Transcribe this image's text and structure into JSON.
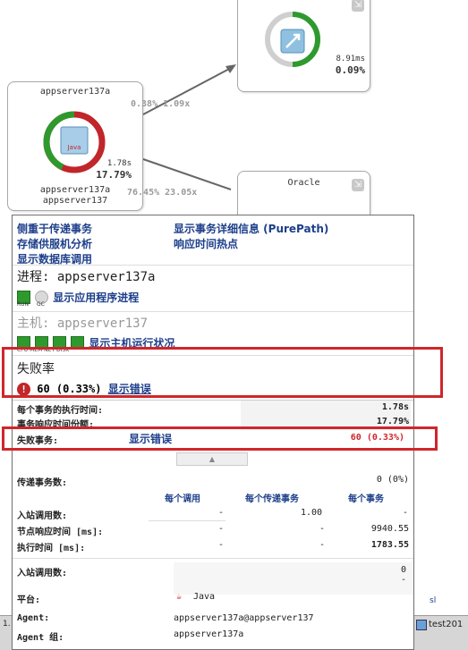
{
  "nodes": {
    "top_right": {
      "metric_ms": "8.91ms",
      "metric_pct": "0.09%"
    },
    "appserver": {
      "title": "appserver137a",
      "java_label": "Java",
      "metric_ms": "1.78s",
      "metric_pct": "17.79%",
      "sub1": "appserver137a",
      "sub2": "appserver137"
    },
    "oracle": {
      "title": "Oracle"
    }
  },
  "edges": {
    "upper": "0.38% 1.09x",
    "lower": "76.45% 23.05x"
  },
  "popup": {
    "links_left": [
      "侧重于传递事务",
      "存储供服机分析",
      "显示数据库调用"
    ],
    "links_right": [
      "显示事务详细信息 (PurePath)",
      "响应时间热点"
    ],
    "process": {
      "title": "进程: appserver137a",
      "link": "显示应用程序进程",
      "labels": [
        "RUN",
        "GC"
      ]
    },
    "host": {
      "title": "主机: appserver137",
      "link": "显示主机运行状况",
      "labels": "CPU MEM NET DISK"
    },
    "failure": {
      "title": "失败率",
      "value": "60 (0.33%)",
      "link": "显示错误"
    },
    "metrics": [
      {
        "label": "每个事务的执行时间:",
        "value": "1.78s"
      },
      {
        "label": "事务响应时间份额:",
        "value": "17.79%"
      }
    ],
    "fail_row": {
      "label": "失败事务:",
      "link": "显示错误",
      "value": "60 (0.33%)"
    },
    "passing": {
      "label": "传递事务数:",
      "value": "0 (0%)"
    },
    "table": {
      "headers": [
        "每个调用",
        "每个传递事务",
        "每个事务"
      ],
      "rows": [
        {
          "label": "入站调用数:",
          "c1": "-",
          "c2": "1.00",
          "c3": "-"
        },
        {
          "label": "节点响应时间 [ms]:",
          "c1": "-",
          "c2": "-",
          "c3": "9940.55"
        },
        {
          "label": "执行时间 [ms]:",
          "c1": "-",
          "c2": "-",
          "c3": "1783.55"
        }
      ]
    },
    "inbound": {
      "label": "入站调用数:",
      "value": "0",
      "dash": "-"
    },
    "platform": {
      "label": "平台:",
      "value": "Java"
    },
    "agent": {
      "label": "Agent:",
      "value": "appserver137a@appserver137"
    },
    "agent_group": {
      "label": "Agent 组:",
      "value": "appserver137a"
    }
  },
  "taskbar": {
    "right_item": "test201",
    "side_label": "sl",
    "left_item": "1."
  },
  "colors": {
    "link": "#1d3f8a",
    "red": "#d0262a",
    "green": "#2e9a2e"
  }
}
